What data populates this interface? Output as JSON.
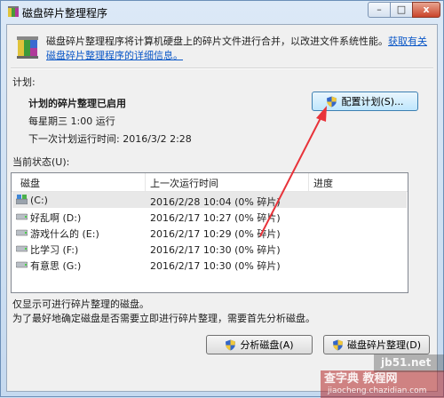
{
  "window": {
    "title": "磁盘碎片整理程序",
    "controls": {
      "minimize": "–",
      "maximize": "□",
      "close": "x"
    }
  },
  "header": {
    "description": "磁盘碎片整理程序将计算机硬盘上的碎片文件进行合并，以改进文件系统性能。",
    "link": "获取有关磁盘碎片整理程序的详细信息。"
  },
  "schedule": {
    "section_label": "计划:",
    "status": "计划的碎片整理已启用",
    "frequency": "每星期三  1:00 运行",
    "next_run": "下一次计划运行时间: 2016/3/2 2:28",
    "configure_button": "配置计划(S)..."
  },
  "current_status": {
    "label": "当前状态(U):",
    "columns": [
      "磁盘",
      "上一次运行时间",
      "进度"
    ],
    "rows": [
      {
        "disk": "(C:)",
        "last_run": "2016/2/28 10:04 (0% 碎片)",
        "progress": "",
        "icon": "system-drive-icon"
      },
      {
        "disk": "好乱啊 (D:)",
        "last_run": "2016/2/17 10:27 (0% 碎片)",
        "progress": "",
        "icon": "drive-icon"
      },
      {
        "disk": "游戏什么的 (E:)",
        "last_run": "2016/2/17 10:29 (0% 碎片)",
        "progress": "",
        "icon": "drive-icon"
      },
      {
        "disk": "比学习 (F:)",
        "last_run": "2016/2/17 10:30 (0% 碎片)",
        "progress": "",
        "icon": "drive-icon"
      },
      {
        "disk": "有意思 (G:)",
        "last_run": "2016/2/17 10:30 (0% 碎片)",
        "progress": "",
        "icon": "drive-icon"
      }
    ]
  },
  "footer": {
    "note1": "仅显示可进行碎片整理的磁盘。",
    "note2": "为了最好地确定磁盘是否需要立即进行碎片整理，需要首先分析磁盘。",
    "analyze_button": "分析磁盘(A)",
    "defrag_button": "磁盘碎片整理(D)"
  },
  "watermark": {
    "site1": "jb51.net",
    "site2": "查字典 教程网",
    "site3": "jiaocheng.chazidian.com"
  },
  "colors": {
    "arrow": "#e8333a",
    "link": "#0b57c7",
    "selection": "#e8e8e8"
  }
}
